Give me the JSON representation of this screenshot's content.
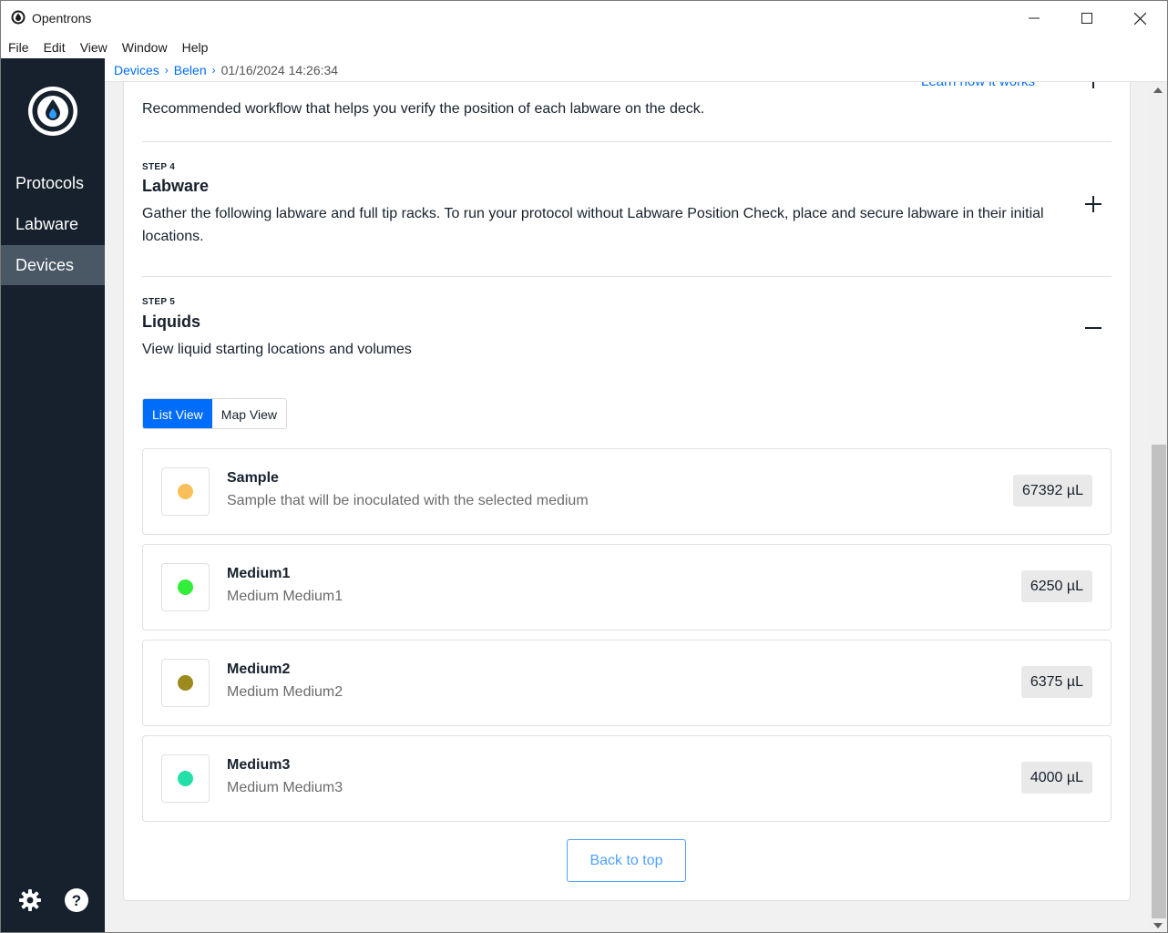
{
  "window": {
    "title": "Opentrons",
    "controls": [
      "minimize",
      "maximize",
      "close"
    ]
  },
  "menubar": {
    "items": [
      "File",
      "Edit",
      "View",
      "Window",
      "Help"
    ]
  },
  "sidebar": {
    "logo_icon": "opentrons-logo-icon",
    "items": [
      {
        "label": "Protocols",
        "active": false
      },
      {
        "label": "Labware",
        "active": false
      },
      {
        "label": "Devices",
        "active": true
      }
    ],
    "bottom_icons": [
      "gear-icon",
      "help-icon"
    ]
  },
  "breadcrumb": {
    "items": [
      "Devices",
      "Belen"
    ],
    "current": "01/16/2024 14:26:34"
  },
  "steps": {
    "partial": {
      "link": "Learn how it works",
      "description": "Recommended workflow that helps you verify the position of each labware on the deck."
    },
    "step4": {
      "label": "STEP 4",
      "title": "Labware",
      "description": "Gather the following labware and full tip racks. To run your protocol without Labware Position Check, place and secure labware in their initial locations.",
      "expanded": false
    },
    "step5": {
      "label": "STEP 5",
      "title": "Liquids",
      "description": "View liquid starting locations and volumes",
      "expanded": true
    }
  },
  "view_toggle": {
    "list_view": "List View",
    "map_view": "Map View",
    "selected": "List View"
  },
  "liquids": [
    {
      "name": "Sample",
      "description": "Sample that will be inoculated with the selected medium",
      "volume": "67392 µL",
      "color": "#fbbf5a"
    },
    {
      "name": "Medium1",
      "description": "Medium Medium1",
      "volume": "6250 µL",
      "color": "#30ee3a"
    },
    {
      "name": "Medium2",
      "description": "Medium Medium2",
      "volume": "6375 µL",
      "color": "#9c8a1d"
    },
    {
      "name": "Medium3",
      "description": "Medium Medium3",
      "volume": "4000 µL",
      "color": "#24e0a8"
    }
  ],
  "back_to_top": "Back to top",
  "colors": {
    "sidebar_bg": "#16212d",
    "sidebar_active": "#4a5765",
    "accent_blue": "#006cfa",
    "content_bg": "#f1f1f1"
  }
}
